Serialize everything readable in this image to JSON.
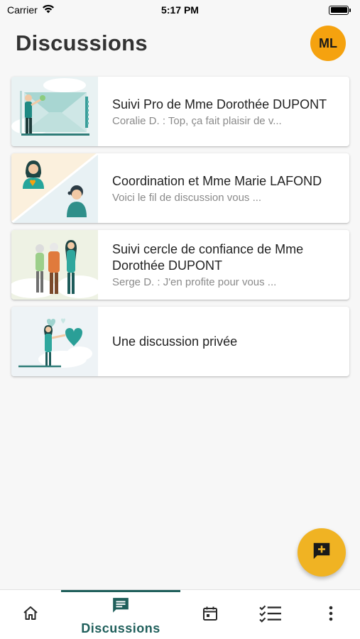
{
  "status_bar": {
    "carrier": "Carrier",
    "time": "5:17 PM",
    "icons": [
      "wifi-icon",
      "battery-icon"
    ]
  },
  "header": {
    "title": "Discussions",
    "avatar_initials": "ML",
    "avatar_color": "#f5a20f"
  },
  "discussions": [
    {
      "title": "Suivi Pro de Mme Dorothée DUPONT",
      "preview": "Coralie D. : Top, ça fait plaisir de v...",
      "thumbnail": "professional-illustration"
    },
    {
      "title": "Coordination et Mme Marie LAFOND",
      "preview": "Voici le fil de discussion vous ...",
      "thumbnail": "coordination-illustration"
    },
    {
      "title": "Suivi cercle de confiance de Mme Dorothée DUPONT",
      "preview": "Serge D. : J'en profite pour vous ...",
      "thumbnail": "family-circle-illustration"
    },
    {
      "title": "Une discussion privée",
      "preview": "",
      "thumbnail": "private-heart-illustration"
    }
  ],
  "fab": {
    "icon": "add-chat-icon",
    "color": "#f0b323"
  },
  "bottom_nav": {
    "active_color": "#1f5f5b",
    "items": [
      {
        "icon": "home-icon",
        "label": ""
      },
      {
        "icon": "chat-icon",
        "label": "Discussions"
      },
      {
        "icon": "calendar-icon",
        "label": ""
      },
      {
        "icon": "checklist-icon",
        "label": ""
      },
      {
        "icon": "more-vertical-icon",
        "label": ""
      }
    ]
  }
}
